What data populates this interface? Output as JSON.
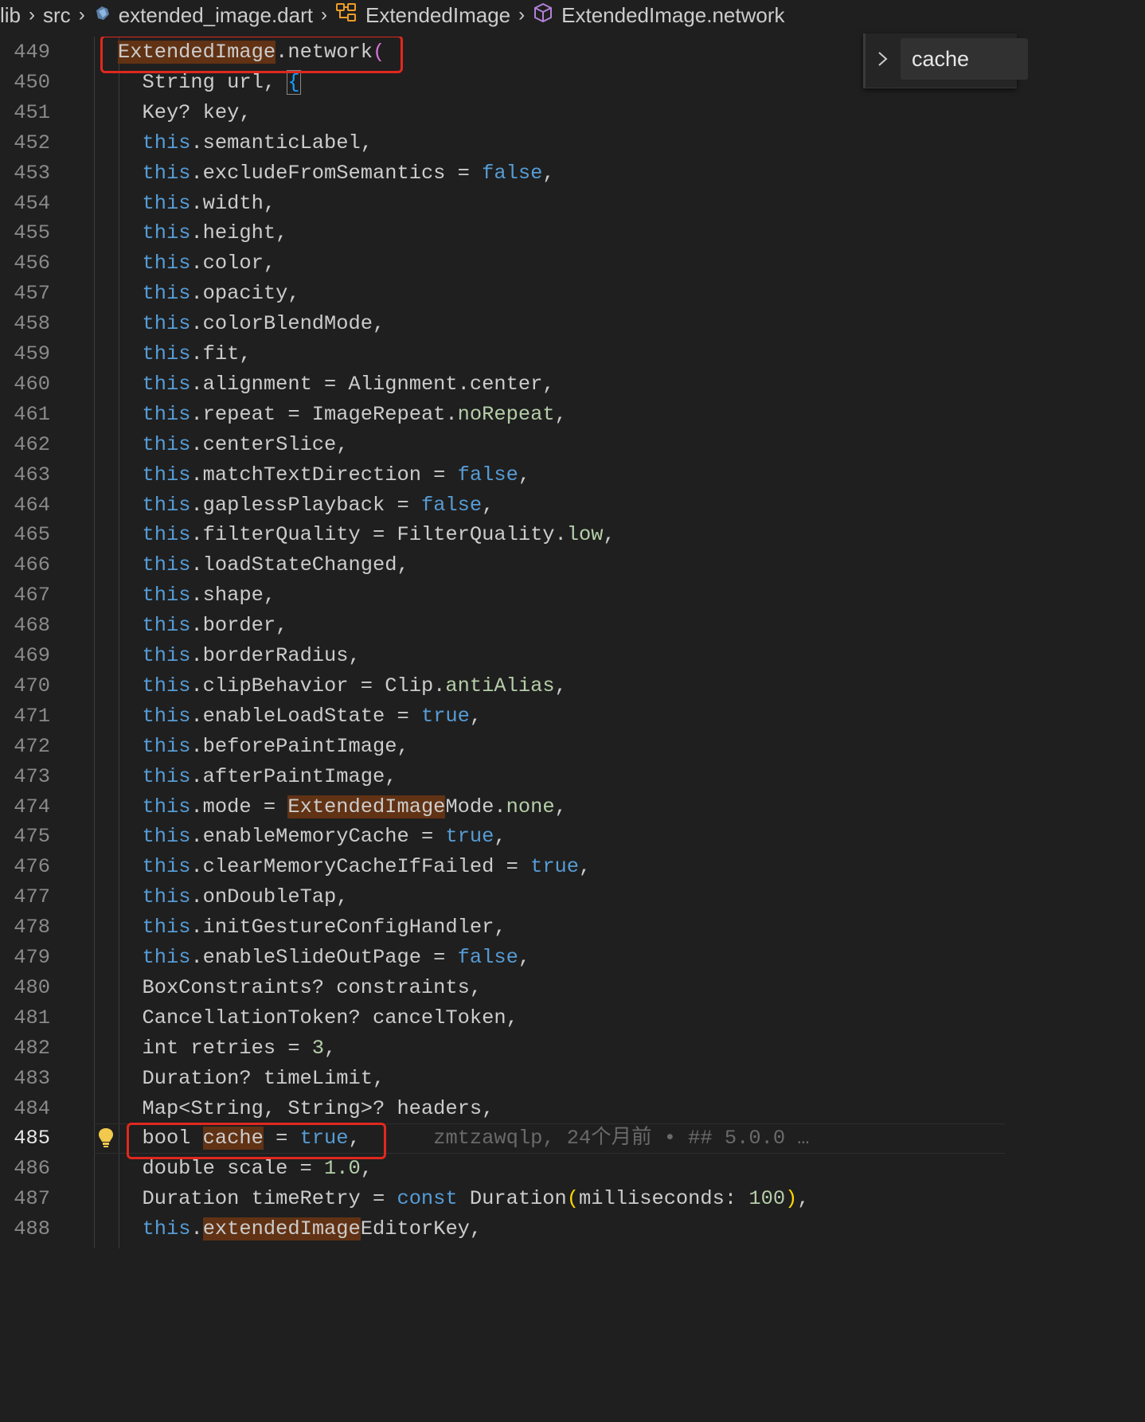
{
  "breadcrumb": {
    "items": [
      {
        "label": "lib",
        "icon": ""
      },
      {
        "label": "src",
        "icon": ""
      },
      {
        "label": "extended_image.dart",
        "icon": "dart-file-icon"
      },
      {
        "label": "ExtendedImage",
        "icon": "class-icon"
      },
      {
        "label": "ExtendedImage.network",
        "icon": "constructor-cube-icon"
      }
    ]
  },
  "find_widget": {
    "query": "cache",
    "toggle_icon": "chevron-right-icon"
  },
  "colors": {
    "background": "#1f1f1f",
    "keyword": "#569cd6",
    "enum_value": "#b5cea8",
    "match_highlight": "#613214",
    "red_annotation": "#e0281e"
  },
  "editor": {
    "active_line": 485,
    "blame": "zmtzawqlp, 24个月前 • ## 5.0.0 …",
    "lines": [
      {
        "n": "449",
        "tokens": [
          [
            "ExtendedImage",
            "hl"
          ],
          [
            ".network",
            ""
          ],
          [
            "(",
            "paren"
          ]
        ]
      },
      {
        "n": "450",
        "tokens": [
          [
            "  String url, ",
            ""
          ],
          [
            "{",
            "brace-br"
          ]
        ]
      },
      {
        "n": "451",
        "tokens": [
          [
            "  Key? key,",
            ""
          ]
        ]
      },
      {
        "n": "452",
        "tokens": [
          [
            "  ",
            ""
          ],
          [
            "this",
            "kw"
          ],
          [
            ".semanticLabel,",
            ""
          ]
        ]
      },
      {
        "n": "453",
        "tokens": [
          [
            "  ",
            ""
          ],
          [
            "this",
            "kw"
          ],
          [
            ".excludeFromSemantics = ",
            ""
          ],
          [
            "false",
            "kw"
          ],
          [
            ",",
            ""
          ]
        ]
      },
      {
        "n": "454",
        "tokens": [
          [
            "  ",
            ""
          ],
          [
            "this",
            "kw"
          ],
          [
            ".width,",
            ""
          ]
        ]
      },
      {
        "n": "455",
        "tokens": [
          [
            "  ",
            ""
          ],
          [
            "this",
            "kw"
          ],
          [
            ".height,",
            ""
          ]
        ]
      },
      {
        "n": "456",
        "tokens": [
          [
            "  ",
            ""
          ],
          [
            "this",
            "kw"
          ],
          [
            ".color,",
            ""
          ]
        ]
      },
      {
        "n": "457",
        "tokens": [
          [
            "  ",
            ""
          ],
          [
            "this",
            "kw"
          ],
          [
            ".opacity,",
            ""
          ]
        ]
      },
      {
        "n": "458",
        "tokens": [
          [
            "  ",
            ""
          ],
          [
            "this",
            "kw"
          ],
          [
            ".colorBlendMode,",
            ""
          ]
        ]
      },
      {
        "n": "459",
        "tokens": [
          [
            "  ",
            ""
          ],
          [
            "this",
            "kw"
          ],
          [
            ".fit,",
            ""
          ]
        ]
      },
      {
        "n": "460",
        "tokens": [
          [
            "  ",
            ""
          ],
          [
            "this",
            "kw"
          ],
          [
            ".alignment = Alignment.center,",
            ""
          ]
        ]
      },
      {
        "n": "461",
        "tokens": [
          [
            "  ",
            ""
          ],
          [
            "this",
            "kw"
          ],
          [
            ".repeat = ImageRepeat.",
            ""
          ],
          [
            "noRepeat",
            "enum"
          ],
          [
            ",",
            ""
          ]
        ]
      },
      {
        "n": "462",
        "tokens": [
          [
            "  ",
            ""
          ],
          [
            "this",
            "kw"
          ],
          [
            ".centerSlice,",
            ""
          ]
        ]
      },
      {
        "n": "463",
        "tokens": [
          [
            "  ",
            ""
          ],
          [
            "this",
            "kw"
          ],
          [
            ".matchTextDirection = ",
            ""
          ],
          [
            "false",
            "kw"
          ],
          [
            ",",
            ""
          ]
        ]
      },
      {
        "n": "464",
        "tokens": [
          [
            "  ",
            ""
          ],
          [
            "this",
            "kw"
          ],
          [
            ".gaplessPlayback = ",
            ""
          ],
          [
            "false",
            "kw"
          ],
          [
            ",",
            ""
          ]
        ]
      },
      {
        "n": "465",
        "tokens": [
          [
            "  ",
            ""
          ],
          [
            "this",
            "kw"
          ],
          [
            ".filterQuality = FilterQuality.",
            ""
          ],
          [
            "low",
            "enum"
          ],
          [
            ",",
            ""
          ]
        ]
      },
      {
        "n": "466",
        "tokens": [
          [
            "  ",
            ""
          ],
          [
            "this",
            "kw"
          ],
          [
            ".loadStateChanged,",
            ""
          ]
        ]
      },
      {
        "n": "467",
        "tokens": [
          [
            "  ",
            ""
          ],
          [
            "this",
            "kw"
          ],
          [
            ".shape,",
            ""
          ]
        ]
      },
      {
        "n": "468",
        "tokens": [
          [
            "  ",
            ""
          ],
          [
            "this",
            "kw"
          ],
          [
            ".border,",
            ""
          ]
        ]
      },
      {
        "n": "469",
        "tokens": [
          [
            "  ",
            ""
          ],
          [
            "this",
            "kw"
          ],
          [
            ".borderRadius,",
            ""
          ]
        ]
      },
      {
        "n": "470",
        "tokens": [
          [
            "  ",
            ""
          ],
          [
            "this",
            "kw"
          ],
          [
            ".clipBehavior = Clip.",
            ""
          ],
          [
            "antiAlias",
            "enum"
          ],
          [
            ",",
            ""
          ]
        ]
      },
      {
        "n": "471",
        "tokens": [
          [
            "  ",
            ""
          ],
          [
            "this",
            "kw"
          ],
          [
            ".enableLoadState = ",
            ""
          ],
          [
            "true",
            "kw"
          ],
          [
            ",",
            ""
          ]
        ]
      },
      {
        "n": "472",
        "tokens": [
          [
            "  ",
            ""
          ],
          [
            "this",
            "kw"
          ],
          [
            ".beforePaintImage,",
            ""
          ]
        ]
      },
      {
        "n": "473",
        "tokens": [
          [
            "  ",
            ""
          ],
          [
            "this",
            "kw"
          ],
          [
            ".afterPaintImage,",
            ""
          ]
        ]
      },
      {
        "n": "474",
        "tokens": [
          [
            "  ",
            ""
          ],
          [
            "this",
            "kw"
          ],
          [
            ".mode = ",
            ""
          ],
          [
            "ExtendedImage",
            "hl"
          ],
          [
            "Mode.",
            ""
          ],
          [
            "none",
            "enum"
          ],
          [
            ",",
            ""
          ]
        ]
      },
      {
        "n": "475",
        "tokens": [
          [
            "  ",
            ""
          ],
          [
            "this",
            "kw"
          ],
          [
            ".enableMemoryCache = ",
            ""
          ],
          [
            "true",
            "kw"
          ],
          [
            ",",
            ""
          ]
        ]
      },
      {
        "n": "476",
        "tokens": [
          [
            "  ",
            ""
          ],
          [
            "this",
            "kw"
          ],
          [
            ".clearMemoryCacheIfFailed = ",
            ""
          ],
          [
            "true",
            "kw"
          ],
          [
            ",",
            ""
          ]
        ]
      },
      {
        "n": "477",
        "tokens": [
          [
            "  ",
            ""
          ],
          [
            "this",
            "kw"
          ],
          [
            ".onDoubleTap,",
            ""
          ]
        ]
      },
      {
        "n": "478",
        "tokens": [
          [
            "  ",
            ""
          ],
          [
            "this",
            "kw"
          ],
          [
            ".initGestureConfigHandler,",
            ""
          ]
        ]
      },
      {
        "n": "479",
        "tokens": [
          [
            "  ",
            ""
          ],
          [
            "this",
            "kw"
          ],
          [
            ".enableSlideOutPage = ",
            ""
          ],
          [
            "false",
            "kw"
          ],
          [
            ",",
            ""
          ]
        ]
      },
      {
        "n": "480",
        "tokens": [
          [
            "  BoxConstraints? constraints,",
            ""
          ]
        ]
      },
      {
        "n": "481",
        "tokens": [
          [
            "  CancellationToken? cancelToken,",
            ""
          ]
        ]
      },
      {
        "n": "482",
        "tokens": [
          [
            "  int retries = ",
            ""
          ],
          [
            "3",
            "num"
          ],
          [
            ",",
            ""
          ]
        ]
      },
      {
        "n": "483",
        "tokens": [
          [
            "  Duration? timeLimit,",
            ""
          ]
        ]
      },
      {
        "n": "484",
        "tokens": [
          [
            "  Map<String, String>? headers,",
            ""
          ]
        ]
      },
      {
        "n": "485",
        "tokens": [
          [
            "  bool ",
            ""
          ],
          [
            "cache",
            "hl"
          ],
          [
            " = ",
            ""
          ],
          [
            "true",
            "kw"
          ],
          [
            ",",
            ""
          ]
        ]
      },
      {
        "n": "486",
        "tokens": [
          [
            "  double scale = ",
            ""
          ],
          [
            "1.0",
            "num"
          ],
          [
            ",",
            ""
          ]
        ]
      },
      {
        "n": "487",
        "tokens": [
          [
            "  Duration timeRetry = ",
            ""
          ],
          [
            "const",
            "kw"
          ],
          [
            " Duration",
            ""
          ],
          [
            "(",
            "paren2"
          ],
          [
            "milliseconds: ",
            ""
          ],
          [
            "100",
            "num"
          ],
          [
            ")",
            "paren2"
          ],
          [
            ",",
            ""
          ]
        ]
      },
      {
        "n": "488",
        "tokens": [
          [
            "  ",
            ""
          ],
          [
            "this",
            "kw"
          ],
          [
            ".",
            ""
          ],
          [
            "extendedImage",
            "hl"
          ],
          [
            "EditorKey,",
            ""
          ]
        ]
      }
    ]
  }
}
